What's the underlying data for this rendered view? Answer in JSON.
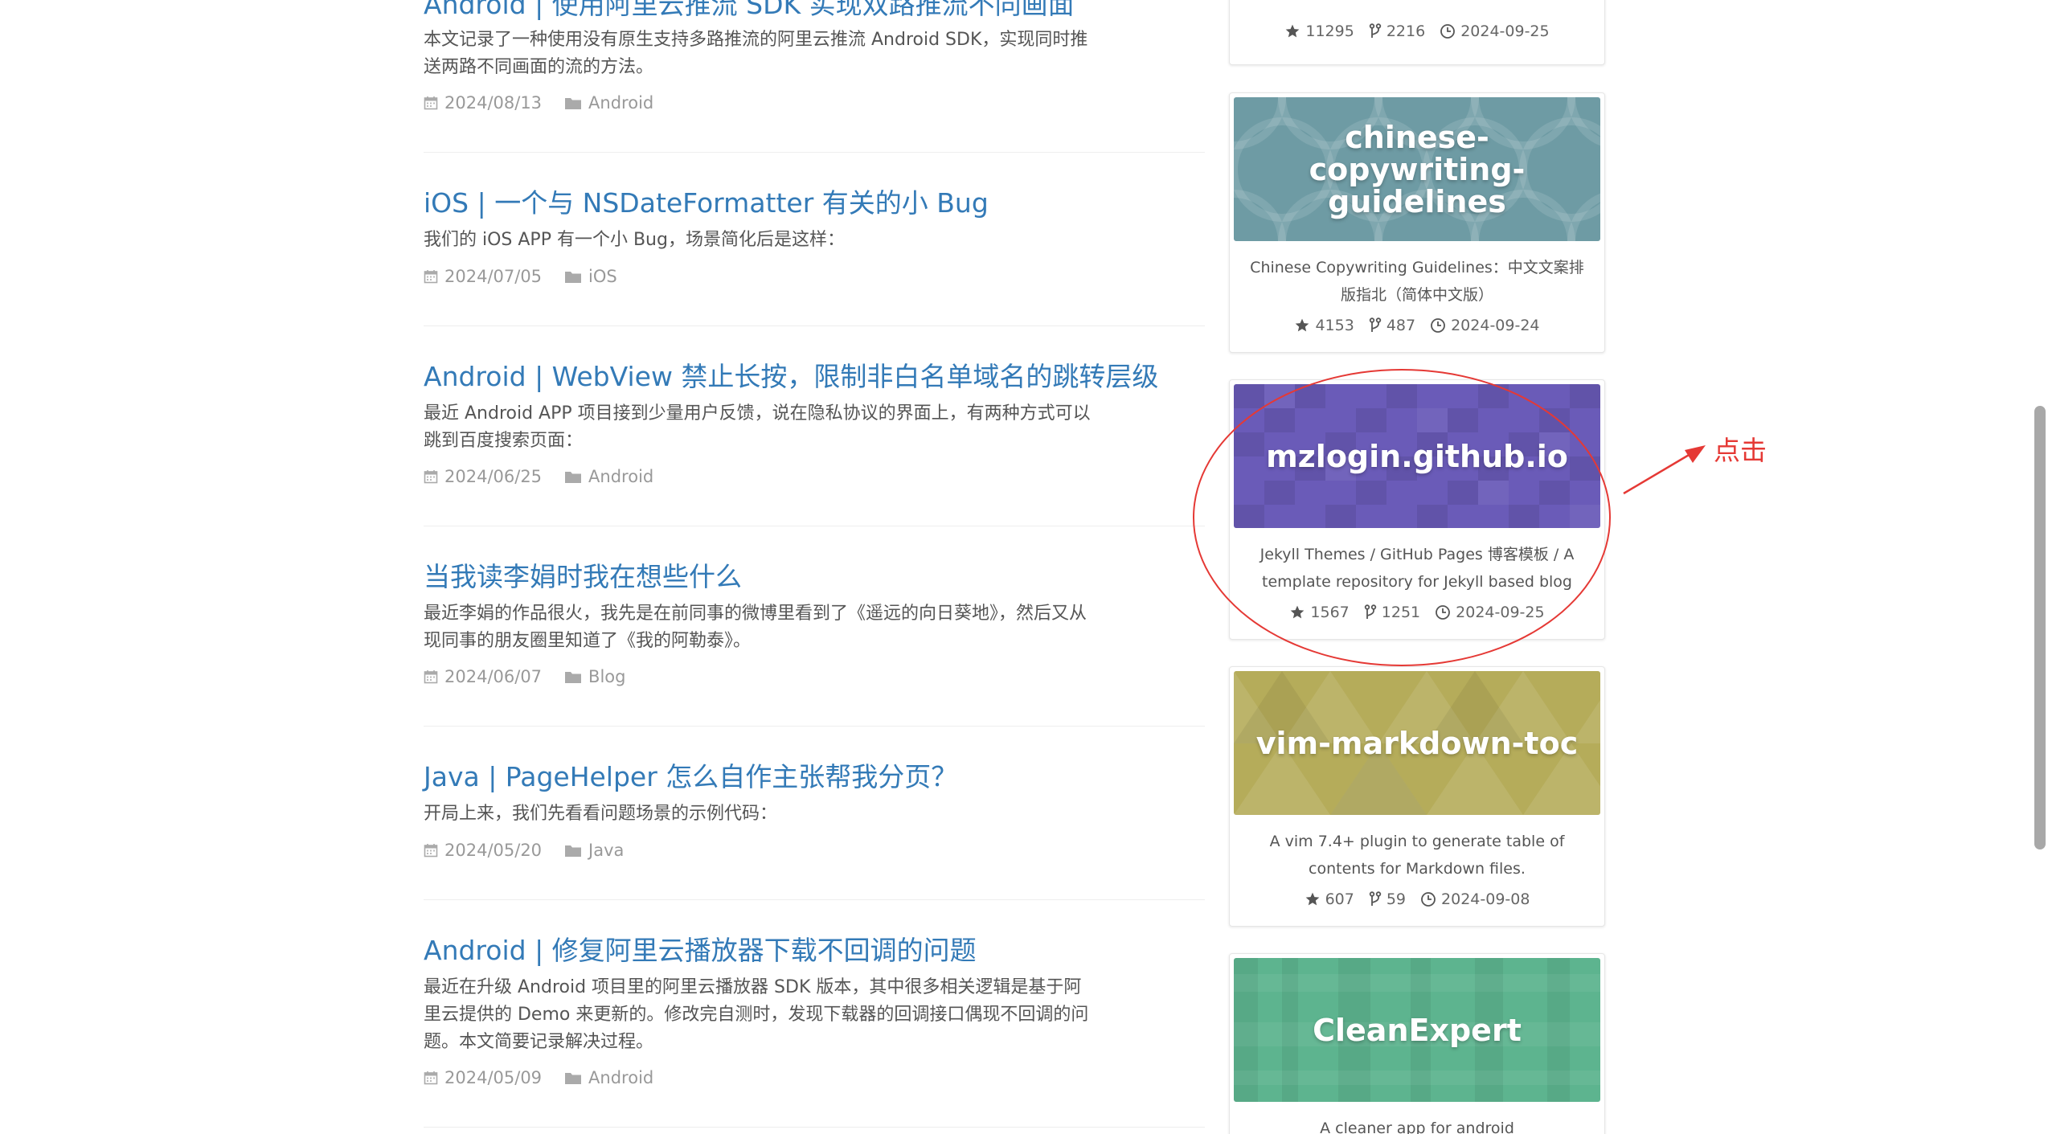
{
  "posts": [
    {
      "title": "Android | 使用阿里云推流 SDK 实现双路推流不同画面",
      "excerpt": "本文记录了一种使用没有原生支持多路推流的阿里云推流 Android SDK，实现同时推送两路不同画面的流的方法。",
      "date": "2024/08/13",
      "category": "Android"
    },
    {
      "title": "iOS | 一个与 NSDateFormatter 有关的小 Bug",
      "excerpt": "我们的 iOS APP 有一个小 Bug，场景简化后是这样：",
      "date": "2024/07/05",
      "category": "iOS"
    },
    {
      "title": "Android | WebView 禁止长按，限制非白名单域名的跳转层级",
      "excerpt": "最近 Android APP 项目接到少量用户反馈，说在隐私协议的界面上，有两种方式可以跳到百度搜索页面：",
      "date": "2024/06/25",
      "category": "Android"
    },
    {
      "title": "当我读李娟时我在想些什么",
      "excerpt": "最近李娟的作品很火，我先是在前同事的微博里看到了《遥远的向日葵地》，然后又从现同事的朋友圈里知道了《我的阿勒泰》。",
      "date": "2024/06/07",
      "category": "Blog"
    },
    {
      "title": "Java | PageHelper 怎么自作主张帮我分页？",
      "excerpt": "开局上来，我们先看看问题场景的示例代码：",
      "date": "2024/05/20",
      "category": "Java"
    },
    {
      "title": "Android | 修复阿里云播放器下载不回调的问题",
      "excerpt": "最近在升级 Android 项目里的阿里云播放器 SDK 版本，其中很多相关逻辑是基于阿里云提供的 Demo 来更新的。修改完自测时，发现下载器的回调接口偶现不回调的问题。本文简要记录解决过程。",
      "date": "2024/05/09",
      "category": "Android"
    }
  ],
  "repos": [
    {
      "name": "",
      "description": "",
      "stars": "11295",
      "forks": "2216",
      "updated": "2024-09-25",
      "cover_color": "#ffffff"
    },
    {
      "name": "chinese-copywriting-guidelines",
      "description": "Chinese Copywriting Guidelines：中文文案排版指北（简体中文版）",
      "stars": "4153",
      "forks": "487",
      "updated": "2024-09-24",
      "cover_color": "#6e9ba4"
    },
    {
      "name": "mzlogin.github.io",
      "description": "Jekyll Themes / GitHub Pages 博客模板 / A template repository for Jekyll based blog",
      "stars": "1567",
      "forks": "1251",
      "updated": "2024-09-25",
      "cover_color": "#6a5bb8"
    },
    {
      "name": "vim-markdown-toc",
      "description": "A vim 7.4+ plugin to generate table of contents for Markdown files.",
      "stars": "607",
      "forks": "59",
      "updated": "2024-09-08",
      "cover_color": "#b5ac5a"
    },
    {
      "name": "CleanExpert",
      "description": "A cleaner app for android",
      "stars": "",
      "forks": "",
      "updated": "",
      "cover_color": "#5db48f"
    }
  ],
  "annotation": {
    "label": "点击",
    "color": "#e53935"
  },
  "icons": {
    "date": "calendar-icon",
    "category": "folder-icon",
    "stars": "star-icon",
    "forks": "fork-icon",
    "updated": "clock-icon"
  },
  "colors": {
    "link": "#337ab7",
    "muted": "#999999",
    "text": "#555555"
  }
}
